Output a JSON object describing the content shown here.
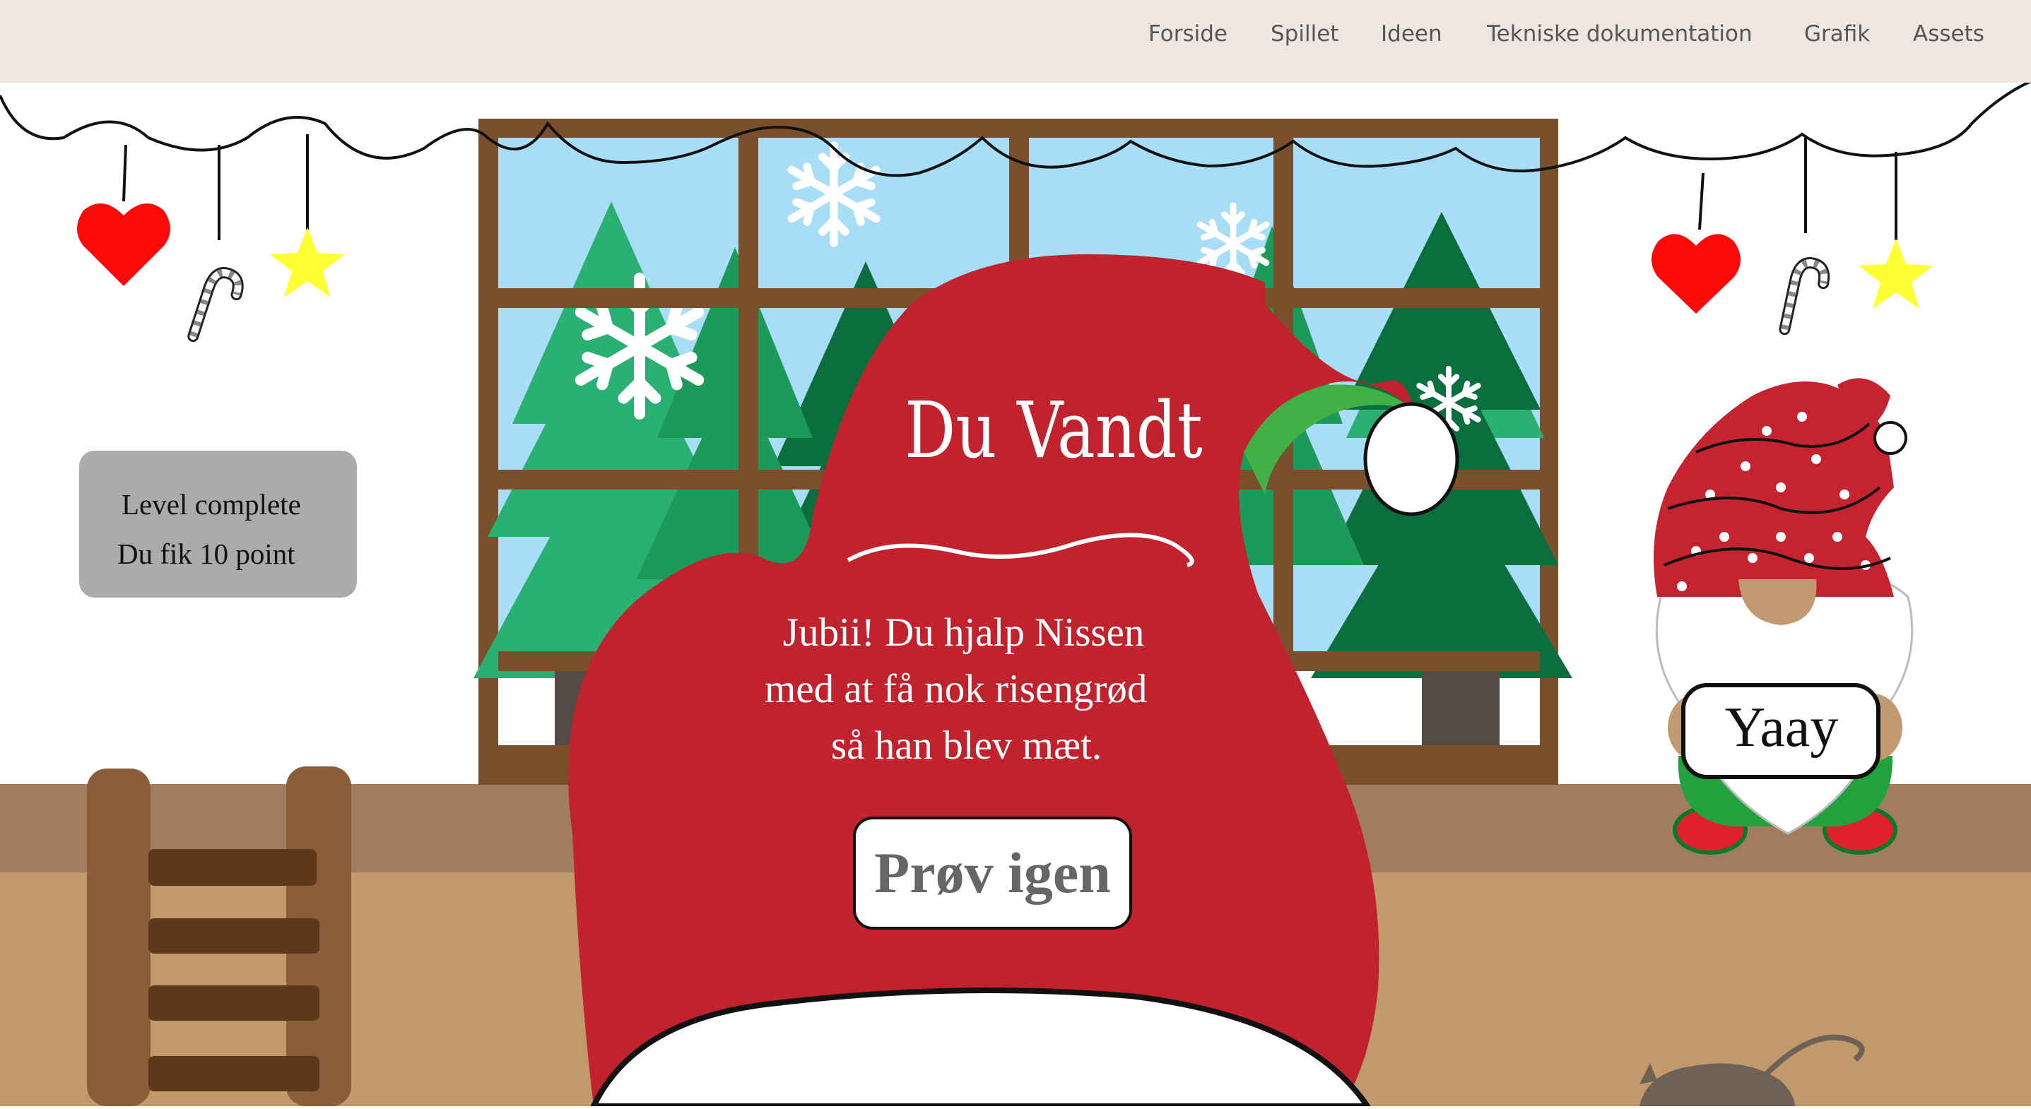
{
  "nav": {
    "items": [
      {
        "label": "Forside"
      },
      {
        "label": "Spillet"
      },
      {
        "label": "Ideen"
      },
      {
        "label": "Tekniske dokumentation"
      },
      {
        "label": "Grafik"
      },
      {
        "label": "Assets"
      }
    ]
  },
  "score": {
    "line1": "Level complete",
    "line2": "Du fik 10 point"
  },
  "win": {
    "title": "Du Vandt",
    "message_lines": [
      "Jubii! Du hjalp Nissen",
      "med at få nok risengrød",
      "så han blev mæt."
    ],
    "retry_label": "Prøv igen"
  },
  "gnome": {
    "sign": "Yaay"
  },
  "colors": {
    "nav_bg": "#ede6e1",
    "hat_red": "#c0232d",
    "floor": "#c19a6b",
    "wall_band": "#a07d5e",
    "window_frame": "#7a4f2c",
    "sky": "#a8ddf7",
    "tree_light": "#2bb073",
    "tree_dark": "#0b6e3f",
    "heart": "#ff0a0a",
    "star": "#ffff33",
    "score_box": "#ababab"
  },
  "icons": [
    "heart-icon",
    "candy-cane-icon",
    "star-icon",
    "snowflake-icon",
    "santa-hat",
    "gnome",
    "ladder",
    "mouse"
  ]
}
